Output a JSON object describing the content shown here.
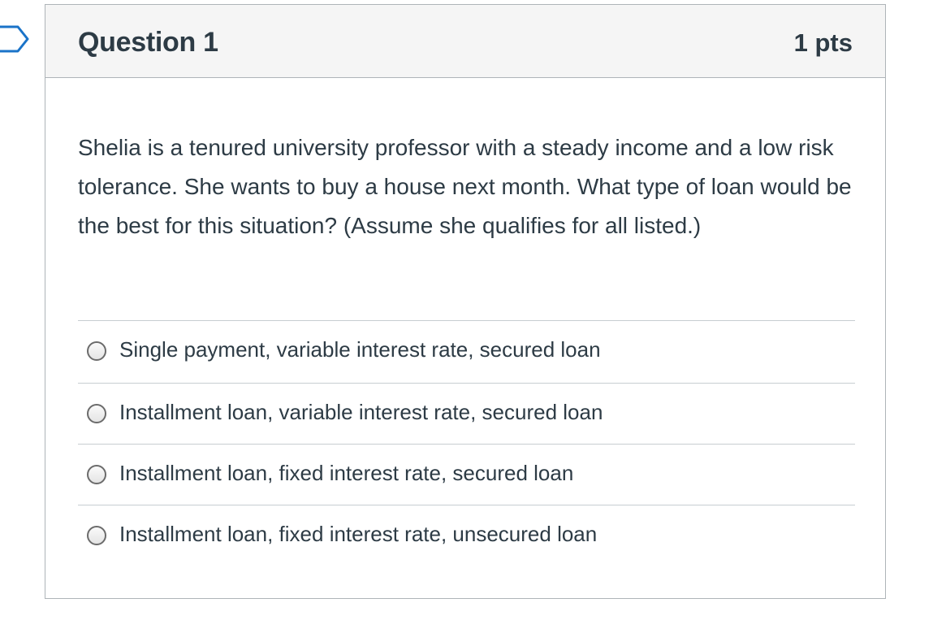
{
  "question": {
    "title": "Question 1",
    "points": "1 pts",
    "text": "Shelia is a tenured university professor with a steady income and a low risk tolerance. She wants to buy a house next month. What type of loan would be the best for this situation? (Assume she qualifies for all listed.)"
  },
  "answers": [
    {
      "label": "Single payment, variable interest rate, secured loan",
      "selected": false
    },
    {
      "label": "Installment loan, variable interest rate, secured loan",
      "selected": false
    },
    {
      "label": "Installment loan, fixed interest rate, secured loan",
      "selected": false
    },
    {
      "label": "Installment loan, fixed interest rate, unsecured loan",
      "selected": false
    }
  ],
  "colors": {
    "text": "#2d3b45",
    "header_bg": "#f5f5f5",
    "border": "#aeb4b8",
    "flag_stroke": "#1a73c8"
  },
  "icons": {
    "flag_marker": "bookmark-flag-icon",
    "radio": "radio-button-icon"
  }
}
